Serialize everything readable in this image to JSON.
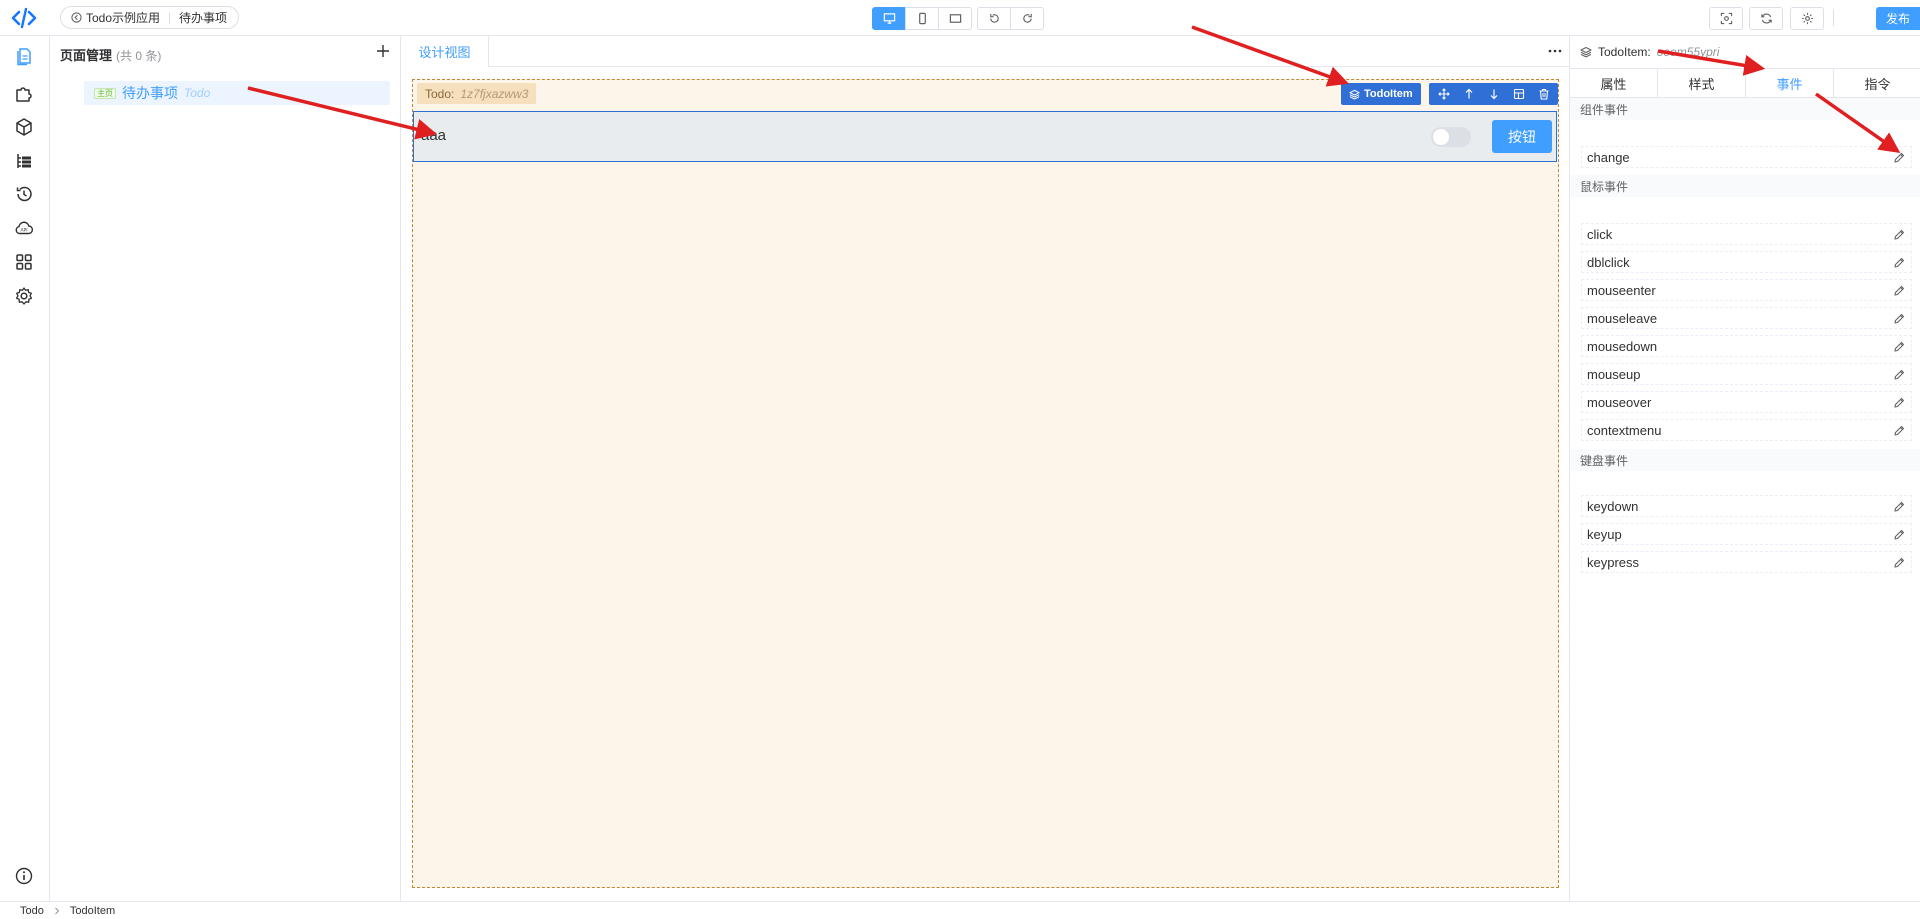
{
  "header": {
    "app_name": "Todo示例应用",
    "page_name": "待办事项",
    "publish_label": "发布"
  },
  "pages_panel": {
    "title": "页面管理",
    "count": "(共 0 条)",
    "items": [
      {
        "tag": "主页",
        "name": "待办事项",
        "code": "Todo"
      }
    ]
  },
  "canvas": {
    "tab_label": "设计视图",
    "root_label": "Todo:",
    "root_id": "1z7fjxazww3",
    "selected_component": "TodoItem",
    "item_text": "aaa",
    "item_button": "按钮"
  },
  "props_panel": {
    "component_name": "TodoItem:",
    "component_id": "oeem55ypri",
    "tabs": [
      "属性",
      "样式",
      "事件",
      "指令"
    ],
    "active_tab": "事件",
    "sections": {
      "component": {
        "title": "组件事件",
        "events": [
          "change"
        ]
      },
      "mouse": {
        "title": "鼠标事件",
        "events": [
          "click",
          "dblclick",
          "mouseenter",
          "mouseleave",
          "mousedown",
          "mouseup",
          "mouseover",
          "contextmenu"
        ]
      },
      "keyboard": {
        "title": "键盘事件",
        "events": [
          "keydown",
          "keyup",
          "keypress"
        ]
      }
    }
  },
  "footer": {
    "breadcrumb": [
      "Todo",
      "TodoItem"
    ]
  },
  "colors": {
    "accent": "#409eff",
    "selection": "#2f6fd6",
    "annotation_arrow": "#e02020"
  }
}
